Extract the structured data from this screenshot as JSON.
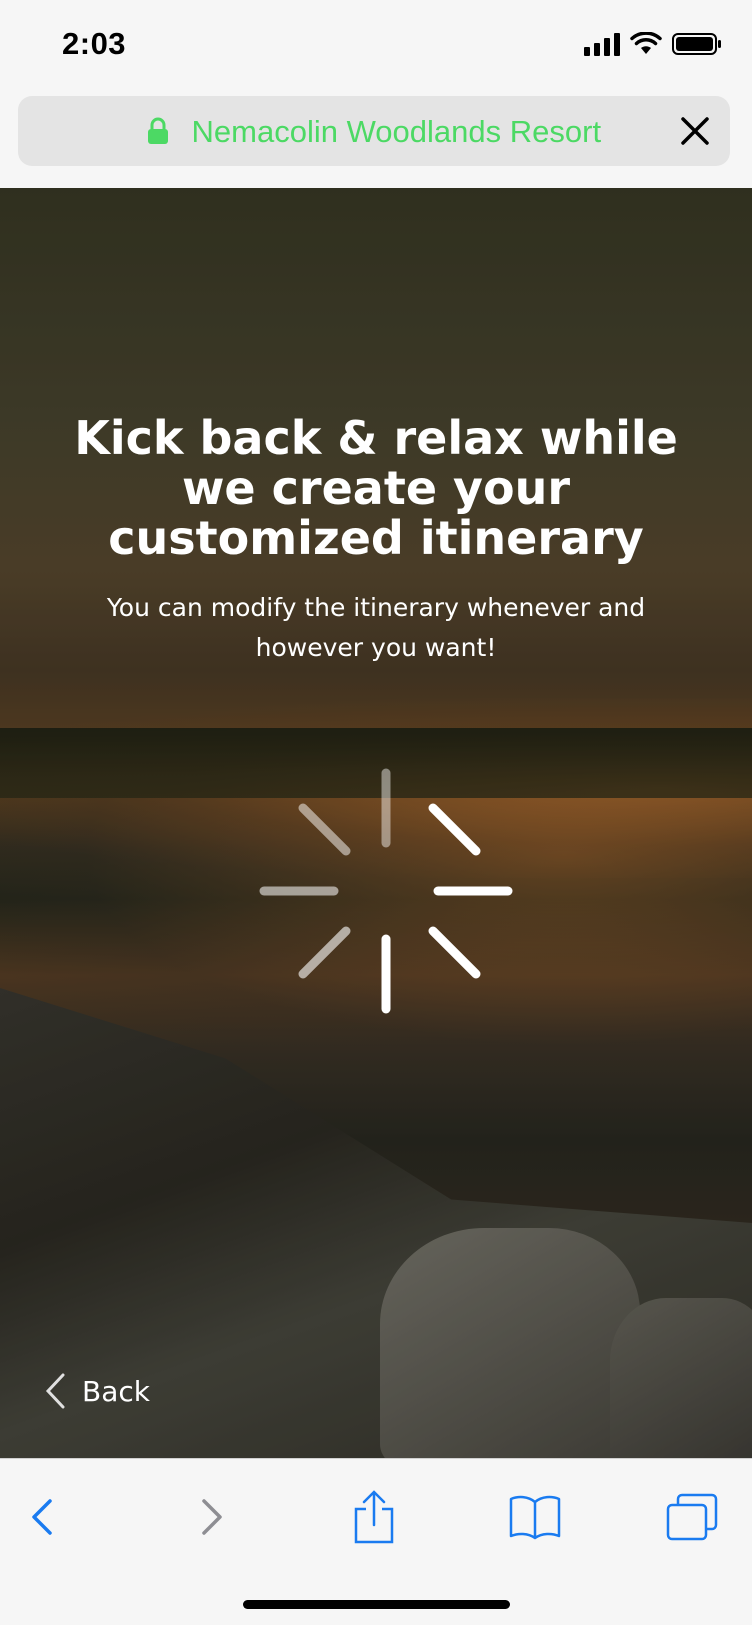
{
  "status_bar": {
    "time": "2:03"
  },
  "browser": {
    "site_title": "Nemacolin Woodlands Resort",
    "site_title_color": "#4cd964"
  },
  "content": {
    "headline": "Kick back & relax while we create your customized itinerary",
    "subtext": "You can modify the itinerary whenever and however you want!",
    "back_label": "Back"
  },
  "icons": {
    "status": [
      "signal-icon",
      "wifi-icon",
      "battery-icon"
    ],
    "address_bar": [
      "lock-icon",
      "close-icon"
    ],
    "toolbar": [
      "back-arrow-icon",
      "forward-arrow-icon",
      "share-icon",
      "bookmarks-icon",
      "tabs-icon"
    ],
    "loading": "spinner-icon"
  },
  "colors": {
    "accent": "#1a7bf0",
    "disabled": "#8e8e93"
  }
}
